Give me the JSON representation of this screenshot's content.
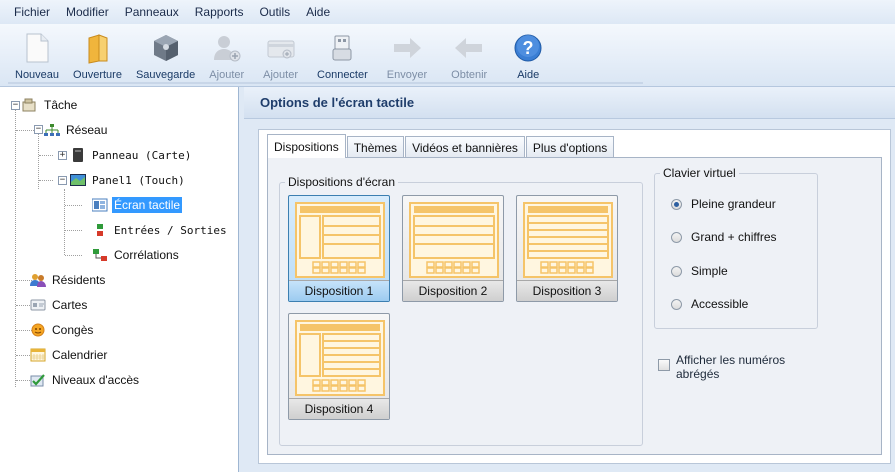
{
  "menu": [
    "Fichier",
    "Modifier",
    "Panneaux",
    "Rapports",
    "Outils",
    "Aide"
  ],
  "toolbar": {
    "buttons": [
      {
        "label": "Nouveau",
        "icon": "new-file-icon",
        "enabled": true
      },
      {
        "label": "Ouverture",
        "icon": "folder-open-icon",
        "enabled": true
      },
      {
        "label": "Sauvegarde",
        "icon": "save-icon",
        "enabled": true
      },
      {
        "label": "Ajouter",
        "icon": "add-user-icon",
        "enabled": false
      },
      {
        "label": "Ajouter",
        "icon": "add-card-icon",
        "enabled": false
      },
      {
        "label": "Connecter",
        "icon": "usb-connect-icon",
        "enabled": true
      },
      {
        "label": "Envoyer",
        "icon": "send-arrow-icon",
        "enabled": false
      },
      {
        "label": "Obtenir",
        "icon": "get-arrow-icon",
        "enabled": false
      },
      {
        "label": "Aide",
        "icon": "help-icon",
        "enabled": true
      }
    ]
  },
  "tree": {
    "root": "Tâche",
    "network": "Réseau",
    "panel_card": "Panneau (Carte)",
    "panel_touch": "Panel1 (Touch)",
    "touch_screen": "Écran tactile",
    "io": "Entrées / Sorties",
    "correlations": "Corrélations",
    "residents": "Résidents",
    "cards": "Cartes",
    "holidays": "Congès",
    "calendar": "Calendrier",
    "access_levels": "Niveaux d'accès"
  },
  "panel": {
    "title": "Options de l'écran tactile",
    "tabs": [
      "Dispositions",
      "Thèmes",
      "Vidéos et bannières",
      "Plus d'options"
    ],
    "active_tab": "Dispositions",
    "layouts_group": "Dispositions d'écran",
    "layouts": [
      "Disposition 1",
      "Disposition 2",
      "Disposition 3",
      "Disposition 4"
    ],
    "selected_layout": "Disposition 1",
    "keyboard_group": "Clavier virtuel",
    "keyboard_options": [
      "Pleine grandeur",
      "Grand + chiffres",
      "Simple",
      "Accessible"
    ],
    "keyboard_selected": "Pleine grandeur",
    "abbrev_label_1": "Afficher les numéros",
    "abbrev_label_2": "abrégés",
    "abbrev_checked": false
  },
  "colors": {
    "accent": "#3399ff",
    "layout_orange": "#f5c469",
    "layout_fill": "#fff6e0",
    "panel_bg": "#dfe9f5"
  }
}
